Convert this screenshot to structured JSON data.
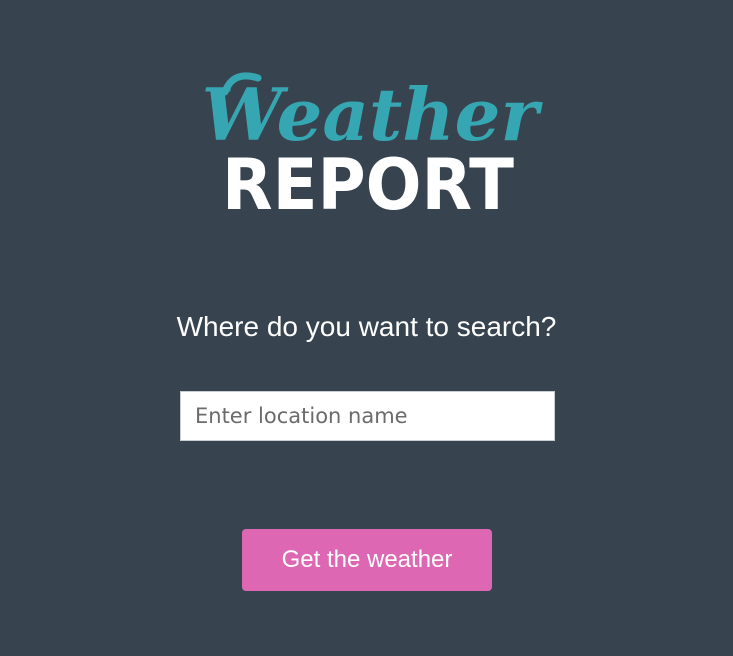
{
  "logo": {
    "line1": "Weather",
    "line2": "REPORT"
  },
  "search": {
    "prompt": "Where do you want to search?",
    "placeholder": "Enter location name",
    "value": ""
  },
  "button": {
    "label": "Get the weather"
  },
  "colors": {
    "background": "#37444f",
    "logo_script": "#35a6b2",
    "logo_block": "#ffffff",
    "button": "#dd67b3",
    "text": "#ffffff"
  }
}
